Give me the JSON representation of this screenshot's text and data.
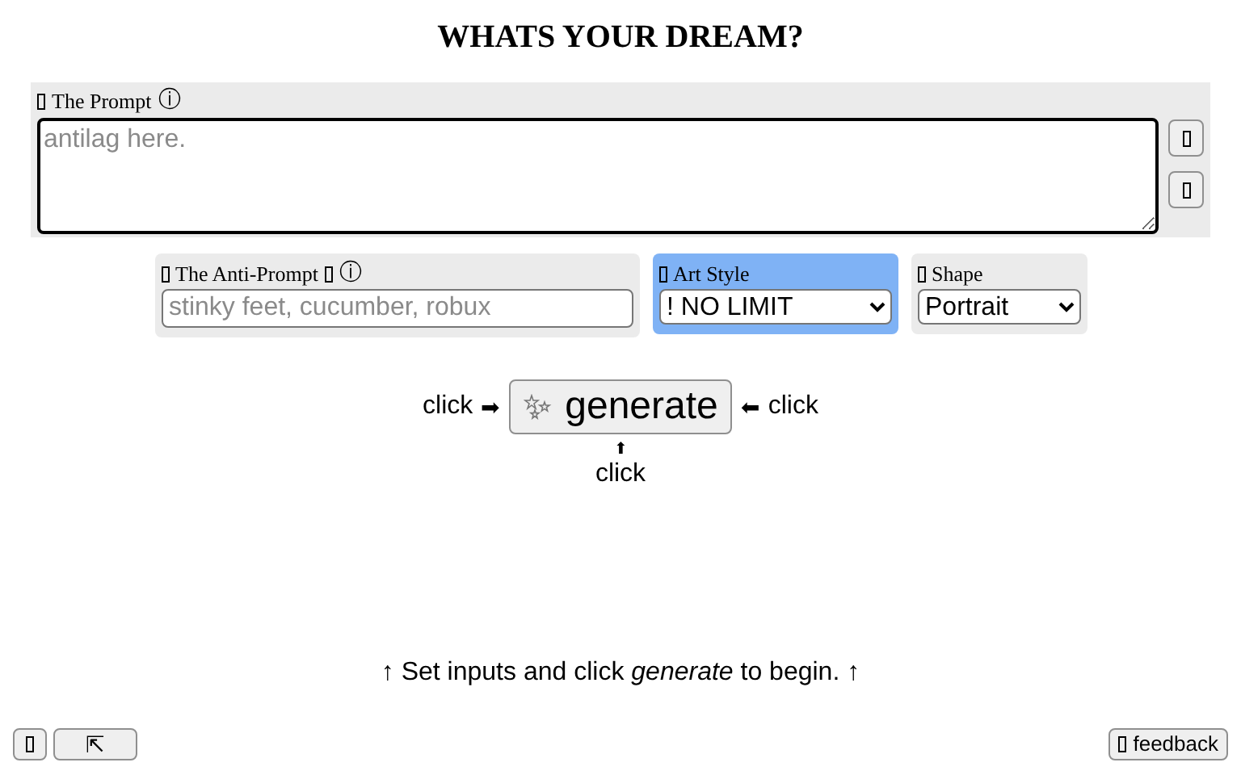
{
  "title": "WHATS YOUR DREAM?",
  "prompt": {
    "label": "The Prompt",
    "info": "ⓘ",
    "placeholder": "antilag here."
  },
  "anti_prompt": {
    "label": "The Anti-Prompt",
    "info": "ⓘ",
    "placeholder": "stinky feet, cucumber, robux",
    "highlighted": false
  },
  "art_style": {
    "label": "Art Style",
    "value": "! NO LIMIT",
    "highlighted": true
  },
  "shape": {
    "label": "Shape",
    "value": "Portrait",
    "highlighted": false
  },
  "generate": {
    "label": "generate",
    "left_hint": "click",
    "left_arrow": "➡",
    "right_arrow": "⬅",
    "right_hint": "click",
    "below_arrow": "⬆",
    "below_hint": "click"
  },
  "message": "↑ Set inputs and click *generate* to begin. ↑",
  "footer": {
    "corner_button": "⇱",
    "feedback": "feedback"
  }
}
